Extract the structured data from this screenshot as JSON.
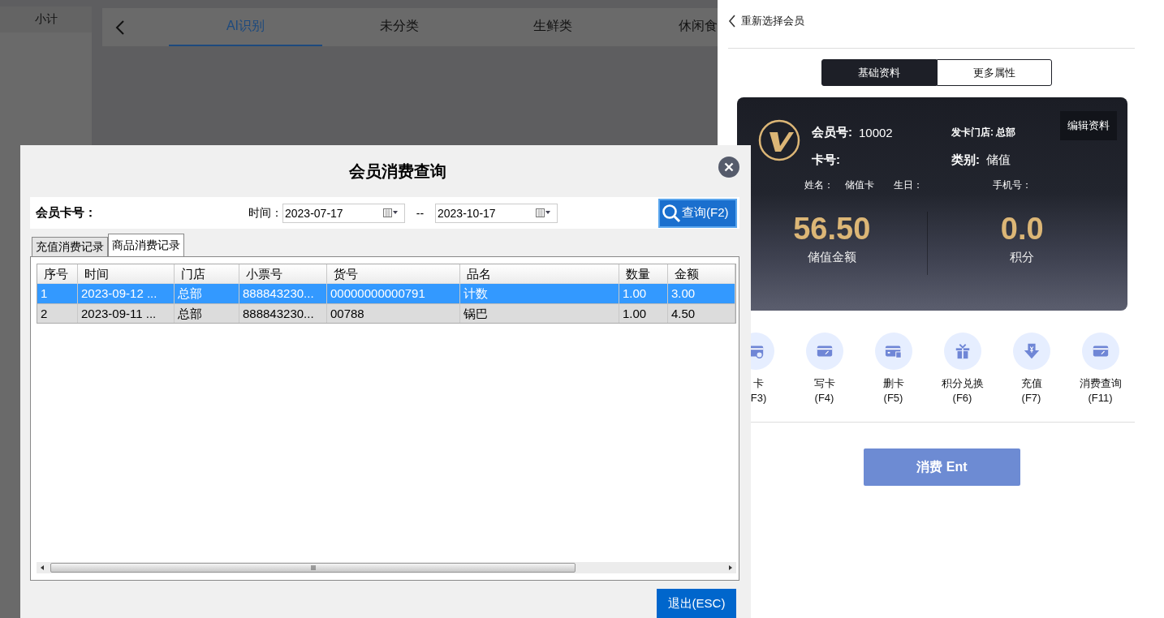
{
  "background": {
    "sidebar": {
      "header": "小计"
    },
    "category_tabs": [
      {
        "label": "AI识别",
        "selected": true
      },
      {
        "label": "未分类",
        "selected": false
      },
      {
        "label": "生鲜类",
        "selected": false
      },
      {
        "label": "休闲食",
        "selected": false
      }
    ]
  },
  "member_panel": {
    "back_label": "重新选择会员",
    "tabs": [
      {
        "label": "基础资料",
        "selected": true
      },
      {
        "label": "更多属性",
        "selected": false
      }
    ],
    "card": {
      "member_no_label": "会员号:",
      "member_no": "10002",
      "store": "发卡门店: 总部",
      "edit_button": "编辑资料",
      "card_no_label": "卡号:",
      "type_label": "类别:",
      "type": "储值",
      "name_label": "姓名：",
      "name": "储值卡",
      "birthday_label": "生日：",
      "phone_label": "手机号：",
      "balance": "56.50",
      "balance_label": "储值金额",
      "points": "0.0",
      "points_label": "积分"
    },
    "actions": [
      {
        "label": "卡",
        "key": "F3)"
      },
      {
        "label": "写卡",
        "key": "(F4)"
      },
      {
        "label": "删卡",
        "key": "(F5)"
      },
      {
        "label": "积分兑换",
        "key": "(F6)"
      },
      {
        "label": "充值",
        "key": "(F7)"
      },
      {
        "label": "消费查询",
        "key": "(F11)"
      }
    ],
    "consume_button": "消费 Ent"
  },
  "dialog": {
    "title": "会员消费查询",
    "card_label": "会员卡号：",
    "time_label": "时间：",
    "date_from": "2023-07-17",
    "date_separator": "--",
    "date_to": "2023-10-17",
    "query_button": "查询(F2)",
    "tabs": [
      {
        "label": "充值消费记录",
        "selected": false
      },
      {
        "label": "商品消费记录",
        "selected": true
      }
    ],
    "table": {
      "columns": [
        "序号",
        "时间",
        "门店",
        "小票号",
        "货号",
        "品名",
        "数量",
        "金额"
      ],
      "rows": [
        {
          "cells": [
            "1",
            "2023-09-12 ...",
            "总部",
            "888843230...",
            "00000000000791",
            "计数",
            "1.00",
            "3.00"
          ],
          "selected": true
        },
        {
          "cells": [
            "2",
            "2023-09-11 ...",
            "总部",
            "888843230...",
            "00788",
            "锅巴",
            "1.00",
            "4.50"
          ],
          "selected": false
        }
      ]
    },
    "exit_button": "退出(ESC)"
  }
}
